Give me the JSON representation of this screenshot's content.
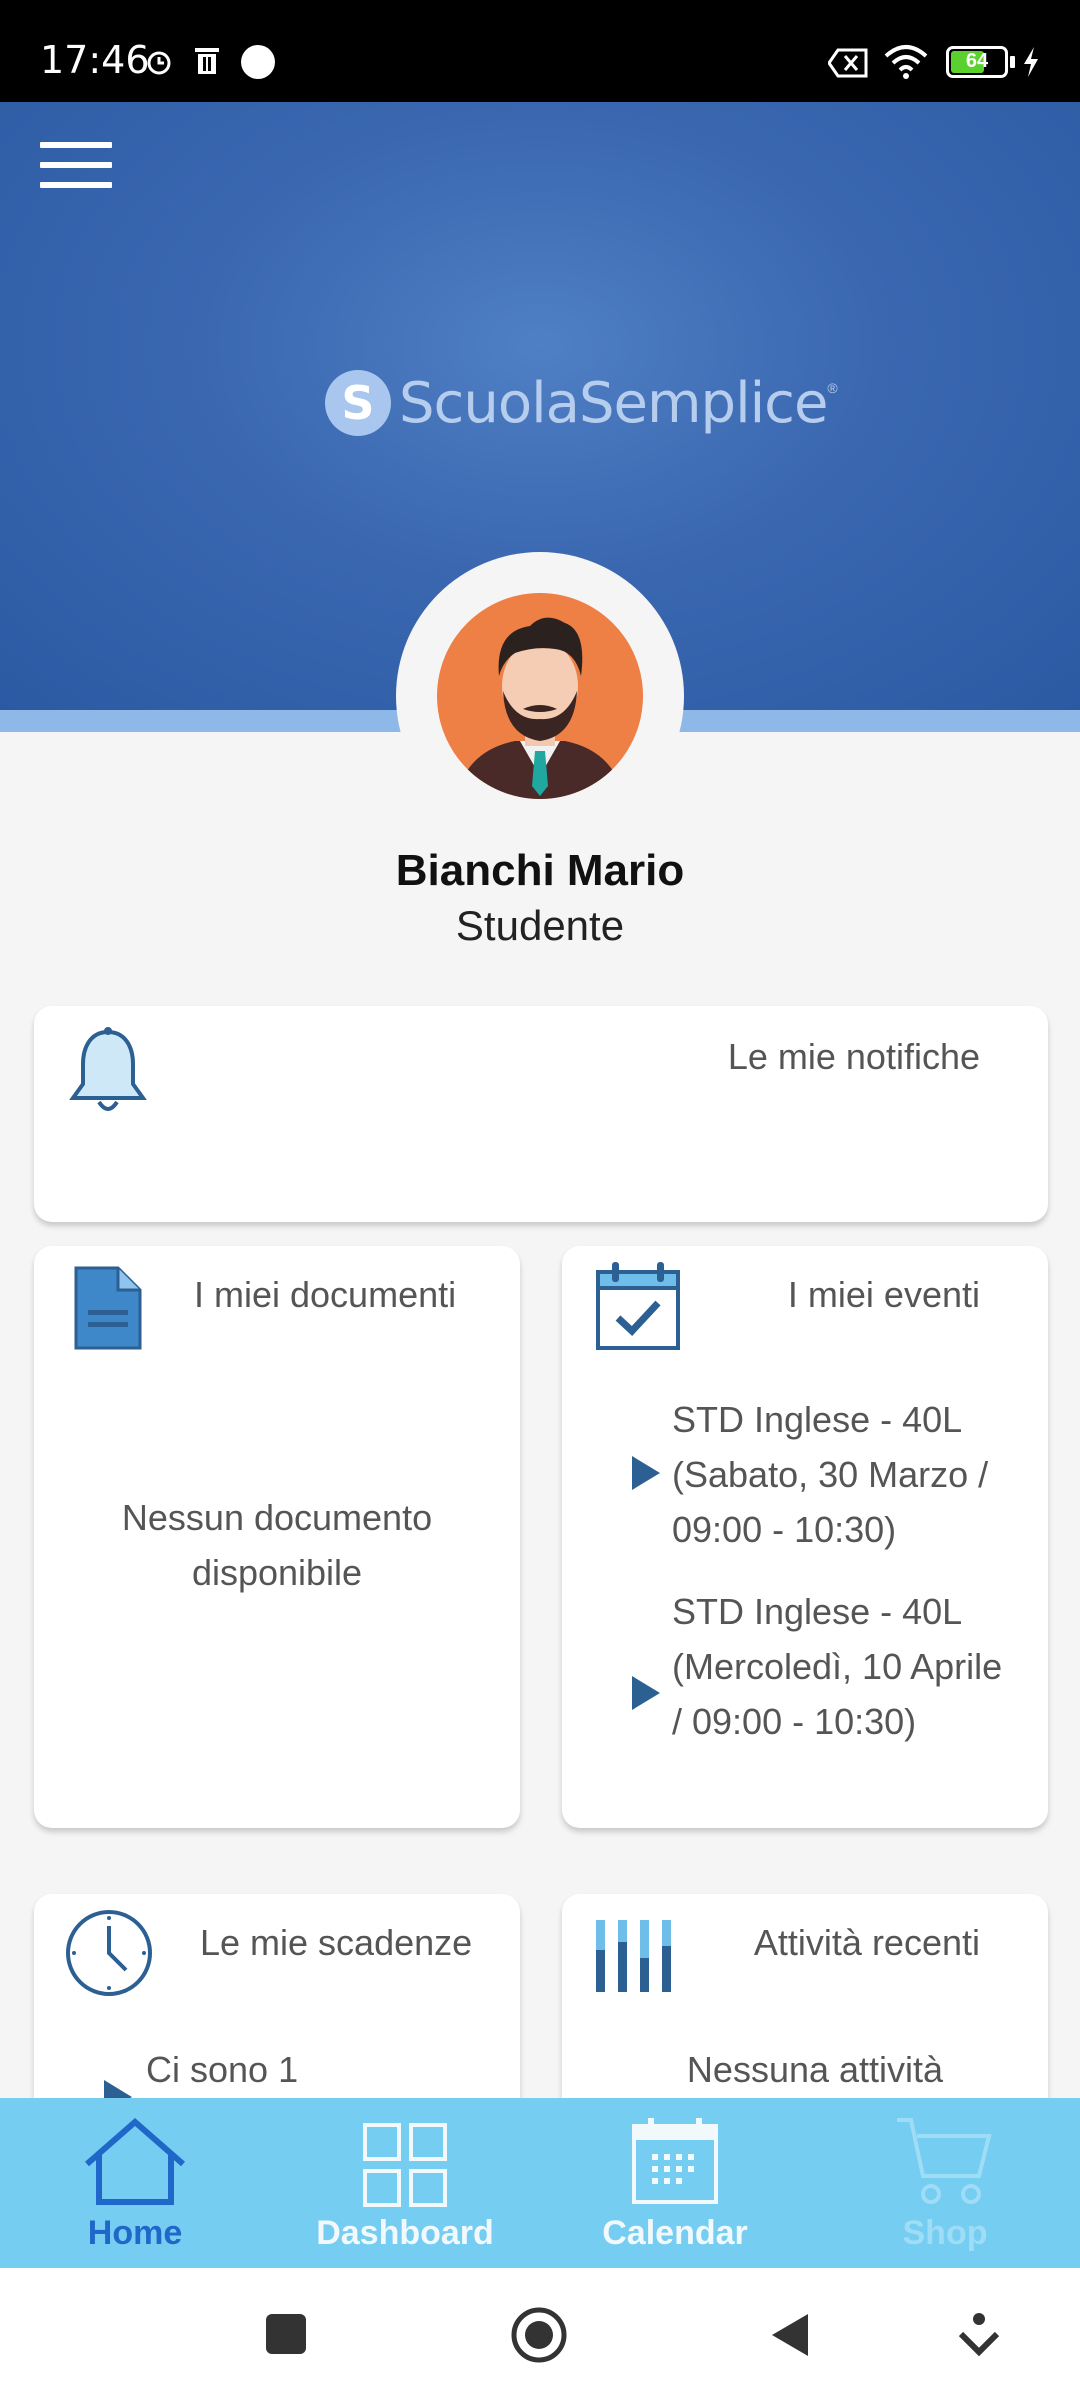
{
  "status_bar": {
    "time": "17:46",
    "battery": "64",
    "icons": [
      "alarm-icon",
      "trash-icon",
      "record-dot-icon",
      "data-off-icon",
      "wifi-icon",
      "battery-icon",
      "charging-icon"
    ]
  },
  "header": {
    "menu_icon": "hamburger-menu-icon",
    "logo_letter": "S",
    "logo_text": "ScuolaSemplice",
    "logo_reg": "®"
  },
  "user": {
    "name": "Bianchi Mario",
    "role": "Studente"
  },
  "cards": {
    "notifications": {
      "title": "Le mie notifiche",
      "icon": "bell-icon"
    },
    "documents": {
      "title": "I miei documenti",
      "icon": "document-icon",
      "empty": "Nessun documento disponibile"
    },
    "events": {
      "title": "I miei eventi",
      "icon": "calendar-check-icon",
      "items": [
        "STD Inglese - 40L (Sabato, 30 Marzo / 09:00 - 10:30)",
        "STD Inglese - 40L (Mercoledì, 10 Aprile / 09:00 - 10:30)"
      ]
    },
    "deadlines": {
      "title": "Le mie scadenze",
      "icon": "clock-icon",
      "text": "Ci sono 1"
    },
    "recent": {
      "title": "Attività recenti",
      "icon": "activity-bars-icon",
      "text": "Nessuna attività"
    }
  },
  "bottom_nav": [
    {
      "label": "Home",
      "icon": "home-icon",
      "state": "active"
    },
    {
      "label": "Dashboard",
      "icon": "dashboard-grid-icon",
      "state": "normal"
    },
    {
      "label": "Calendar",
      "icon": "calendar-icon",
      "state": "normal"
    },
    {
      "label": "Shop",
      "icon": "shopping-cart-icon",
      "state": "muted"
    }
  ],
  "colors": {
    "header_blue": "#3a67b0",
    "nav_bar": "#75cdf1",
    "active_nav": "#1f67c8",
    "icon_blue": "#2c5f92"
  }
}
